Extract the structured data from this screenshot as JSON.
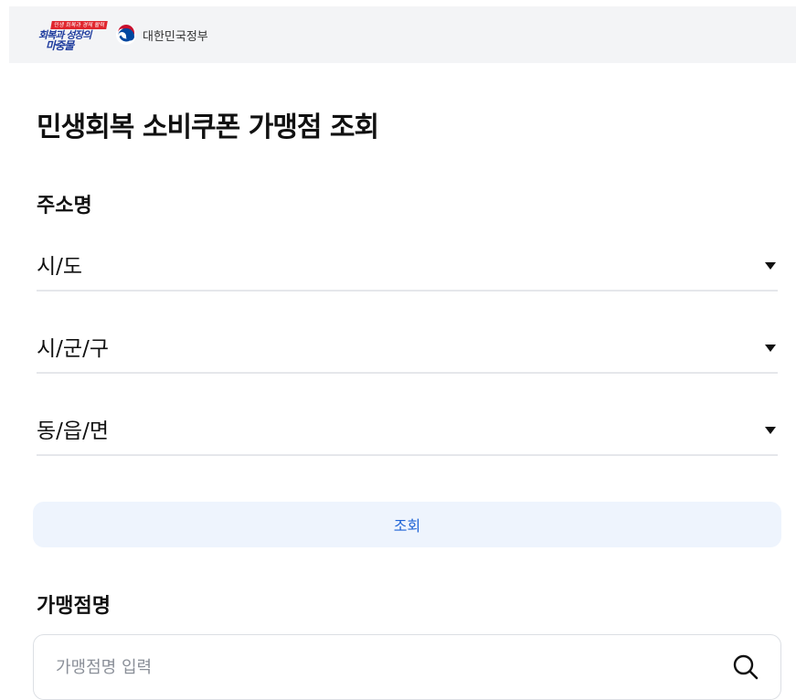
{
  "header": {
    "campaign_logo": {
      "tag_text": "민생 회복과 경제 활력",
      "line1": "회복과 성장의",
      "line2": "마중물"
    },
    "government_logo": {
      "icon": "taegeuk-emblem-icon",
      "name": "대한민국정부"
    }
  },
  "page": {
    "title": "민생회복 소비쿠폰 가맹점 조회"
  },
  "address": {
    "label": "주소명",
    "selects": [
      {
        "value": "시/도",
        "icon": "caret-down-icon"
      },
      {
        "value": "시/군/구",
        "icon": "caret-down-icon"
      },
      {
        "value": "동/읍/면",
        "icon": "caret-down-icon"
      }
    ],
    "search_button_label": "조회"
  },
  "store_name": {
    "label": "가맹점명",
    "placeholder": "가맹점명 입력",
    "icon": "search-icon"
  },
  "colors": {
    "header_bg": "#f3f4f6",
    "button_bg": "#eef4fd",
    "button_text": "#1e63d6",
    "logo_blue": "#1f3c9e",
    "logo_red": "#e0262e"
  }
}
